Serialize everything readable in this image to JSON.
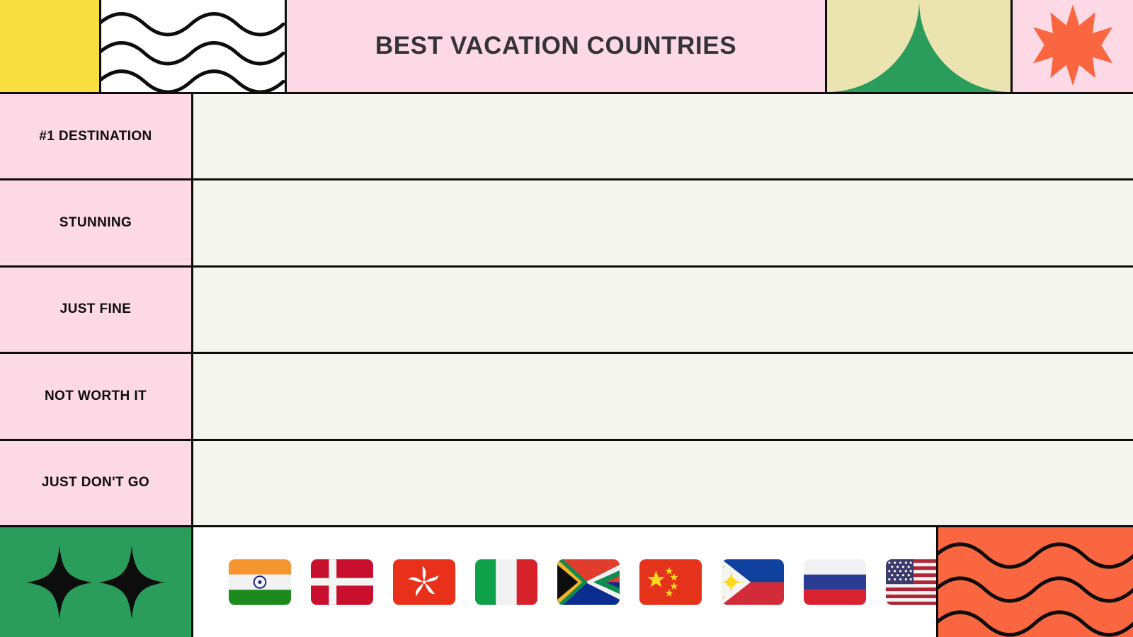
{
  "header": {
    "title": "BEST VACATION COUNTRIES",
    "decor": {
      "yellow_block": "yellow-block",
      "wave_panel": "wave-lines",
      "leaf_panel": "leaf-arch",
      "star_badge": "ten-point-star"
    },
    "colors": {
      "yellow": "#F7DF3F",
      "pink": "#FCD9E4",
      "green": "#2A9D5C",
      "cream": "#EBE3B0",
      "orange": "#FA6640",
      "ink": "#0D0D0D",
      "title_text": "#333338"
    }
  },
  "tiers": [
    {
      "label": "#1 DESTINATION",
      "items": []
    },
    {
      "label": "STUNNING",
      "items": []
    },
    {
      "label": "JUST FINE",
      "items": []
    },
    {
      "label": "NOT WORTH IT",
      "items": []
    },
    {
      "label": "JUST DON'T GO",
      "items": []
    }
  ],
  "footer": {
    "sparkle_count": 2,
    "flags": [
      {
        "name": "India",
        "icon": "flag-india"
      },
      {
        "name": "Denmark",
        "icon": "flag-denmark"
      },
      {
        "name": "Hong Kong",
        "icon": "flag-hong-kong"
      },
      {
        "name": "Italy",
        "icon": "flag-italy"
      },
      {
        "name": "South Africa",
        "icon": "flag-south-africa"
      },
      {
        "name": "China",
        "icon": "flag-china"
      },
      {
        "name": "Philippines",
        "icon": "flag-philippines"
      },
      {
        "name": "Russia",
        "icon": "flag-russia"
      },
      {
        "name": "United States",
        "icon": "flag-united-states"
      }
    ],
    "orange_panel": "wave-lines"
  }
}
